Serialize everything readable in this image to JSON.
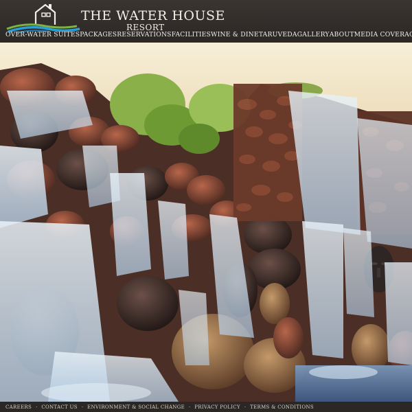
{
  "header": {
    "title": "THE WATER HOUSE",
    "subtitle": "RESORT"
  },
  "nav": {
    "items": [
      {
        "label": "OVER-WATER SUITES",
        "name": "nav-item-over-water-suites"
      },
      {
        "label": "PACKAGES",
        "name": "nav-item-packages"
      },
      {
        "label": "RESERVATIONS",
        "name": "nav-item-reservations"
      },
      {
        "label": "FACILITIES",
        "name": "nav-item-facilities"
      },
      {
        "label": "WINE & DINE",
        "name": "nav-item-wine-dine"
      },
      {
        "label": "TARUVEDA",
        "name": "nav-item-taruveda"
      },
      {
        "label": "GALLERY",
        "name": "nav-item-gallery"
      },
      {
        "label": "ABOUT",
        "name": "nav-item-about"
      },
      {
        "label": "MEDIA COVERAGE",
        "name": "nav-item-media-coverage"
      }
    ]
  },
  "hero": {
    "icon": "waterfall-photo"
  },
  "footer": {
    "items": [
      {
        "label": "CAREERS",
        "name": "footer-link-careers"
      },
      {
        "label": "CONTACT US",
        "name": "footer-link-contact-us"
      },
      {
        "label": "ENVIRONMENT & SOCIAL CHANGE",
        "name": "footer-link-environment"
      },
      {
        "label": "PRIVACY POLICY",
        "name": "footer-link-privacy-policy"
      },
      {
        "label": "TERMS & CONDITIONS",
        "name": "footer-link-terms"
      }
    ]
  },
  "colors": {
    "header_bg": "#2f2b28",
    "logo_water": "#2a9fd6",
    "logo_grass": "#7cb342",
    "text_light": "#f4efe6"
  }
}
